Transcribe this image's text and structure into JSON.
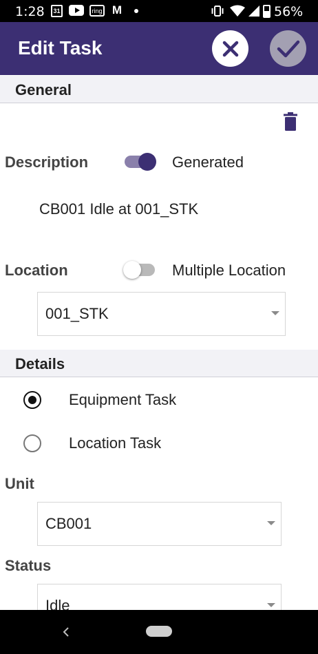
{
  "status_bar": {
    "time": "1:28",
    "calendar_label": "31",
    "ring_label": "ring",
    "mail_label": "M",
    "battery": "56%",
    "icons": [
      "calendar-icon",
      "youtube-icon",
      "ring-icon",
      "gmail-icon",
      "dot-icon",
      "vibrate-icon",
      "wifi-icon",
      "cellular-icon",
      "battery-icon"
    ]
  },
  "appbar": {
    "title": "Edit Task",
    "cancel_icon": "close-icon",
    "confirm_icon": "check-icon",
    "colors": {
      "background": "#3c2f73",
      "confirm_disabled": "#a3a0b2"
    }
  },
  "general": {
    "header": "General",
    "delete_icon": "trash-icon",
    "description_label": "Description",
    "generated_label": "Generated",
    "generated_on": true,
    "description_value": "CB001 Idle at 001_STK",
    "location_label": "Location",
    "multiple_location_label": "Multiple Location",
    "multiple_location_on": false,
    "location_value": "001_STK"
  },
  "details": {
    "header": "Details",
    "task_types": [
      {
        "label": "Equipment Task",
        "selected": true
      },
      {
        "label": "Location Task",
        "selected": false
      }
    ],
    "unit_label": "Unit",
    "unit_value": "CB001",
    "status_label": "Status",
    "status_value": "Idle"
  },
  "nav": {
    "back_icon": "back-icon",
    "home_icon": "home-pill-icon"
  }
}
